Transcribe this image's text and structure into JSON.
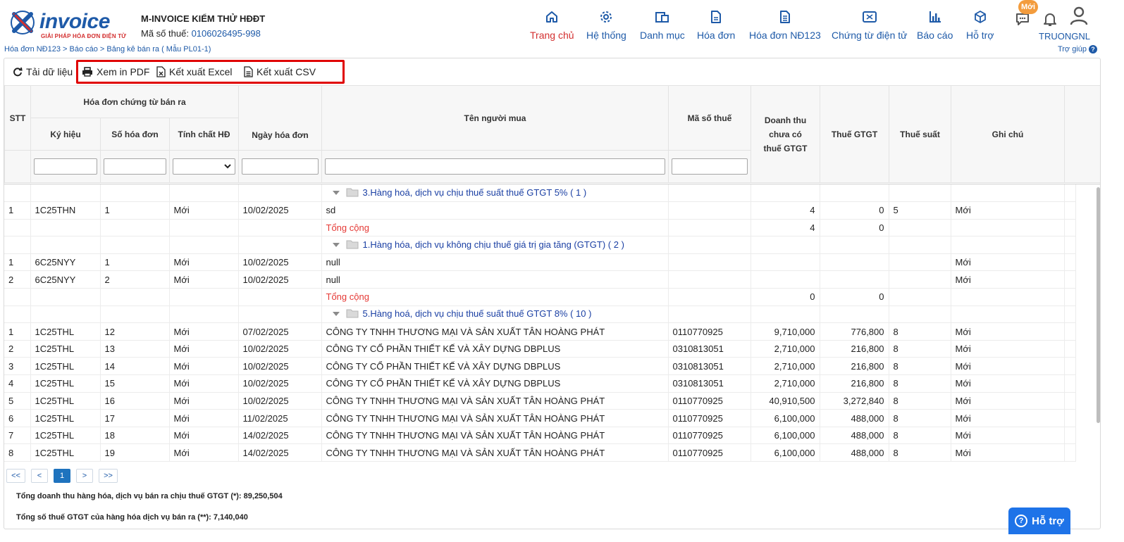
{
  "header": {
    "logo_text": "invoice",
    "logo_tagline": "GIẢI PHÁP HÓA ĐƠN ĐIỆN TỬ",
    "company_name": "M-INVOICE KIỂM THỬ HĐĐT",
    "tax_label": "Mã số thuế:",
    "tax_code": "0106026495-998",
    "nav": [
      {
        "label": "Trang chủ",
        "icon": "home-icon",
        "active": true
      },
      {
        "label": "Hệ thống",
        "icon": "gear-icon"
      },
      {
        "label": "Danh mục",
        "icon": "catalog-icon"
      },
      {
        "label": "Hóa đơn",
        "icon": "document-icon"
      },
      {
        "label": "Hóa đơn NĐ123",
        "icon": "document-lines-icon"
      },
      {
        "label": "Chứng từ điện tử",
        "icon": "voucher-icon"
      },
      {
        "label": "Báo cáo",
        "icon": "bar-chart-icon"
      },
      {
        "label": "Hỗ trợ",
        "icon": "cube-icon"
      }
    ],
    "badge_new": "Mới",
    "username": "TRUONGNL"
  },
  "breadcrumb": "Hóa đơn NĐ123 > Báo cáo > Bảng kê bán ra ( Mẫu PL01-1)",
  "help_link": "Trợ giúp",
  "toolbar": {
    "reload": "Tải dữ liệu",
    "pdf": "Xem in PDF",
    "excel": "Kết xuất Excel",
    "csv": "Kết xuất CSV"
  },
  "columns": {
    "stt": "STT",
    "group_header": "Hóa đơn chứng từ bán ra",
    "ky_hieu": "Ký hiệu",
    "so_hoa_don": "Số hóa đơn",
    "tinh_chat": "Tính chất HĐ",
    "ngay_hoa_don": "Ngày hóa đơn",
    "ten_nguoi_mua": "Tên người mua",
    "ma_so_thue": "Mã số thuế",
    "doanh_thu": "Doanh thu chưa có thuế GTGT",
    "thue_gtgt": "Thuế GTGT",
    "thue_suat": "Thuế suất",
    "ghi_chu": "Ghi chú"
  },
  "rows": [
    {
      "type": "group",
      "label": "3.Hàng hoá, dịch vụ chịu thuế suất thuế GTGT 5% ( 1 )"
    },
    {
      "type": "data",
      "stt": "1",
      "ky_hieu": "1C25THN",
      "so": "1",
      "tinh_chat": "Mới",
      "ngay": "10/02/2025",
      "ten": "sd",
      "mst": "",
      "doanh_thu": "4",
      "thue": "0",
      "thue_suat": "5",
      "ghi_chu": "Mới"
    },
    {
      "type": "total",
      "label": "Tổng cộng",
      "doanh_thu": "4",
      "thue": "0"
    },
    {
      "type": "group",
      "label": "1.Hàng hóa, dịch vụ không chịu thuế giá trị gia tăng (GTGT) ( 2 )"
    },
    {
      "type": "data",
      "stt": "1",
      "ky_hieu": "6C25NYY",
      "so": "1",
      "tinh_chat": "Mới",
      "ngay": "10/02/2025",
      "ten": "null",
      "mst": "",
      "doanh_thu": "",
      "thue": "",
      "thue_suat": "",
      "ghi_chu": "Mới"
    },
    {
      "type": "data",
      "stt": "2",
      "ky_hieu": "6C25NYY",
      "so": "2",
      "tinh_chat": "Mới",
      "ngay": "10/02/2025",
      "ten": "null",
      "mst": "",
      "doanh_thu": "",
      "thue": "",
      "thue_suat": "",
      "ghi_chu": "Mới"
    },
    {
      "type": "total",
      "label": "Tổng cộng",
      "doanh_thu": "0",
      "thue": "0"
    },
    {
      "type": "group",
      "label": "5.Hàng hoá, dịch vụ chịu thuế suất thuế GTGT 8% ( 10 )"
    },
    {
      "type": "data",
      "stt": "1",
      "ky_hieu": "1C25THL",
      "so": "12",
      "tinh_chat": "Mới",
      "ngay": "07/02/2025",
      "ten": "CÔNG TY TNHH THƯƠNG MẠI VÀ SẢN XUẤT TÂN HOÀNG PHÁT",
      "mst": "0110770925",
      "doanh_thu": "9,710,000",
      "thue": "776,800",
      "thue_suat": "8",
      "ghi_chu": "Mới"
    },
    {
      "type": "data",
      "stt": "2",
      "ky_hieu": "1C25THL",
      "so": "13",
      "tinh_chat": "Mới",
      "ngay": "10/02/2025",
      "ten": "CÔNG TY CỔ PHẦN THIẾT KẾ VÀ XÂY DỰNG DBPLUS",
      "mst": "0310813051",
      "doanh_thu": "2,710,000",
      "thue": "216,800",
      "thue_suat": "8",
      "ghi_chu": "Mới"
    },
    {
      "type": "data",
      "stt": "3",
      "ky_hieu": "1C25THL",
      "so": "14",
      "tinh_chat": "Mới",
      "ngay": "10/02/2025",
      "ten": "CÔNG TY CỔ PHẦN THIẾT KẾ VÀ XÂY DỰNG DBPLUS",
      "mst": "0310813051",
      "doanh_thu": "2,710,000",
      "thue": "216,800",
      "thue_suat": "8",
      "ghi_chu": "Mới"
    },
    {
      "type": "data",
      "stt": "4",
      "ky_hieu": "1C25THL",
      "so": "15",
      "tinh_chat": "Mới",
      "ngay": "10/02/2025",
      "ten": "CÔNG TY CỔ PHẦN THIẾT KẾ VÀ XÂY DỰNG DBPLUS",
      "mst": "0310813051",
      "doanh_thu": "2,710,000",
      "thue": "216,800",
      "thue_suat": "8",
      "ghi_chu": "Mới"
    },
    {
      "type": "data",
      "stt": "5",
      "ky_hieu": "1C25THL",
      "so": "16",
      "tinh_chat": "Mới",
      "ngay": "10/02/2025",
      "ten": "CÔNG TY TNHH THƯƠNG MẠI VÀ SẢN XUẤT TÂN HOÀNG PHÁT",
      "mst": "0110770925",
      "doanh_thu": "40,910,500",
      "thue": "3,272,840",
      "thue_suat": "8",
      "ghi_chu": "Mới"
    },
    {
      "type": "data",
      "stt": "6",
      "ky_hieu": "1C25THL",
      "so": "17",
      "tinh_chat": "Mới",
      "ngay": "11/02/2025",
      "ten": "CÔNG TY TNHH THƯƠNG MẠI VÀ SẢN XUẤT TÂN HOÀNG PHÁT",
      "mst": "0110770925",
      "doanh_thu": "6,100,000",
      "thue": "488,000",
      "thue_suat": "8",
      "ghi_chu": "Mới"
    },
    {
      "type": "data",
      "stt": "7",
      "ky_hieu": "1C25THL",
      "so": "18",
      "tinh_chat": "Mới",
      "ngay": "14/02/2025",
      "ten": "CÔNG TY TNHH THƯƠNG MẠI VÀ SẢN XUẤT TÂN HOÀNG PHÁT",
      "mst": "0110770925",
      "doanh_thu": "6,100,000",
      "thue": "488,000",
      "thue_suat": "8",
      "ghi_chu": "Mới"
    },
    {
      "type": "data",
      "stt": "8",
      "ky_hieu": "1C25THL",
      "so": "19",
      "tinh_chat": "Mới",
      "ngay": "14/02/2025",
      "ten": "CÔNG TY TNHH THƯƠNG MẠI VÀ SẢN XUẤT TÂN HOÀNG PHÁT",
      "mst": "0110770925",
      "doanh_thu": "6,100,000",
      "thue": "488,000",
      "thue_suat": "8",
      "ghi_chu": "Mới"
    }
  ],
  "pager": {
    "first": "<<",
    "prev": "<",
    "current": "1",
    "next": ">",
    "last": ">>"
  },
  "summary": {
    "line1": "Tổng doanh thu hàng hóa, dịch vụ bán ra chịu thuế GTGT (*): 89,250,504",
    "line2": "Tổng số thuế GTGT của hàng hóa dịch vụ bán ra (**): 7,140,040"
  },
  "support_button": "Hỗ trợ",
  "colors": {
    "brand_blue": "#1e5aa8",
    "accent_red": "#d32f2f",
    "badge_orange": "#f39c3d",
    "support_blue": "#1e73e8"
  }
}
